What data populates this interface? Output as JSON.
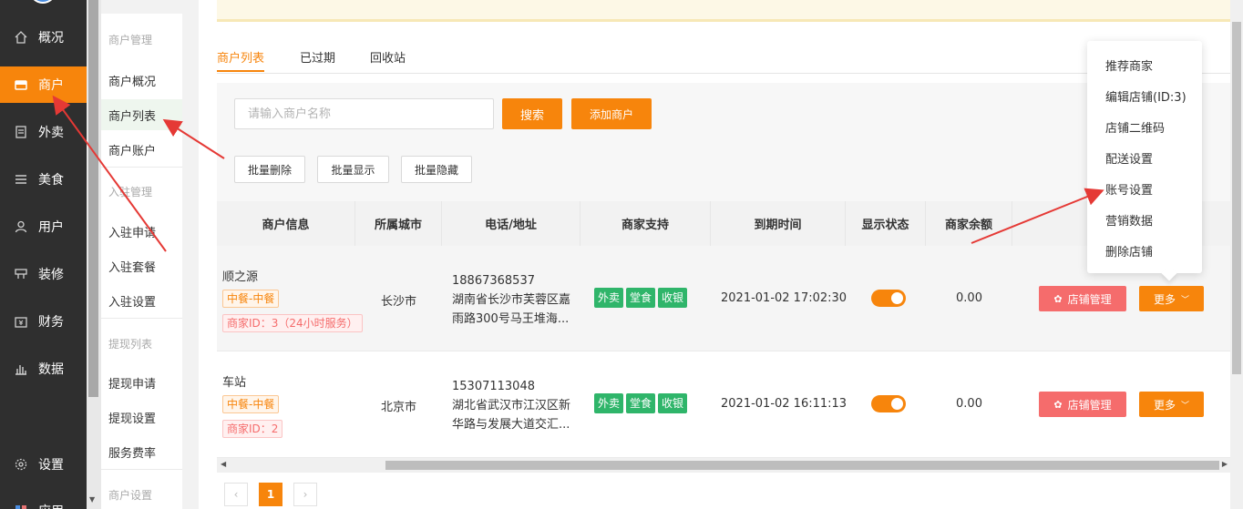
{
  "nav": {
    "items": [
      {
        "label": "概况",
        "icon": "home-icon"
      },
      {
        "label": "商户",
        "icon": "shop-icon"
      },
      {
        "label": "外卖",
        "icon": "document-icon"
      },
      {
        "label": "美食",
        "icon": "menu-icon"
      },
      {
        "label": "用户",
        "icon": "user-icon"
      },
      {
        "label": "装修",
        "icon": "decor-icon"
      },
      {
        "label": "财务",
        "icon": "finance-icon"
      },
      {
        "label": "数据",
        "icon": "bar-chart-icon"
      },
      {
        "label": "设置",
        "icon": "gear-icon"
      },
      {
        "label": "应用",
        "icon": "apps-icon"
      }
    ]
  },
  "subnav": {
    "groups": [
      {
        "title": "商户管理",
        "items": [
          "商户概况",
          "商户列表",
          "商户账户"
        ]
      },
      {
        "title": "入驻管理",
        "items": [
          "入驻申请",
          "入驻套餐",
          "入驻设置"
        ]
      },
      {
        "title": "提现列表",
        "items": [
          "提现申请",
          "提现设置",
          "服务费率"
        ]
      },
      {
        "title": "商户设置",
        "items": []
      }
    ]
  },
  "tabs": [
    "商户列表",
    "已过期",
    "回收站"
  ],
  "filter": {
    "search_placeholder": "请输入商户名称",
    "search_label": "搜索",
    "add_label": "添加商户",
    "batch_delete": "批量删除",
    "batch_show": "批量显示",
    "batch_hide": "批量隐藏"
  },
  "table": {
    "headers": [
      "商户信息",
      "所属城市",
      "电话/地址",
      "商家支持",
      "到期时间",
      "显示状态",
      "商家余额"
    ],
    "rows": [
      {
        "name": "顺之源",
        "package": "中餐-中餐",
        "merchant_id": "商家ID：3（24小时服务）",
        "city": "长沙市",
        "phone": "18867368537",
        "address": "湖南省长沙市芙蓉区嘉雨路300号马王堆海...",
        "support": [
          "外卖",
          "堂食",
          "收银"
        ],
        "expire": "2021-01-02 17:02:30",
        "display_on": true,
        "balance": "0.00",
        "manage_label": "店铺管理",
        "more_label": "更多"
      },
      {
        "name": "车站",
        "package": "中餐-中餐",
        "merchant_id": "商家ID：2",
        "city": "北京市",
        "phone": "15307113048",
        "address": "湖北省武汉市江汉区新华路与发展大道交汇...",
        "support": [
          "外卖",
          "堂食",
          "收银"
        ],
        "expire": "2021-01-02 16:11:13",
        "display_on": true,
        "balance": "0.00",
        "manage_label": "店铺管理",
        "more_label": "更多"
      }
    ]
  },
  "pager": {
    "prev": "‹",
    "current": "1",
    "next": "›"
  },
  "dropdown": {
    "items": [
      "推荐商家",
      "编辑店铺(ID:3)",
      "店铺二维码",
      "配送设置",
      "账号设置",
      "营销数据",
      "删除店铺"
    ]
  },
  "colors": {
    "accent": "#f7850c",
    "nav_bg": "#2f2f2f",
    "danger": "#f56c6c",
    "success": "#2fb56a",
    "arrow": "#e53935"
  }
}
